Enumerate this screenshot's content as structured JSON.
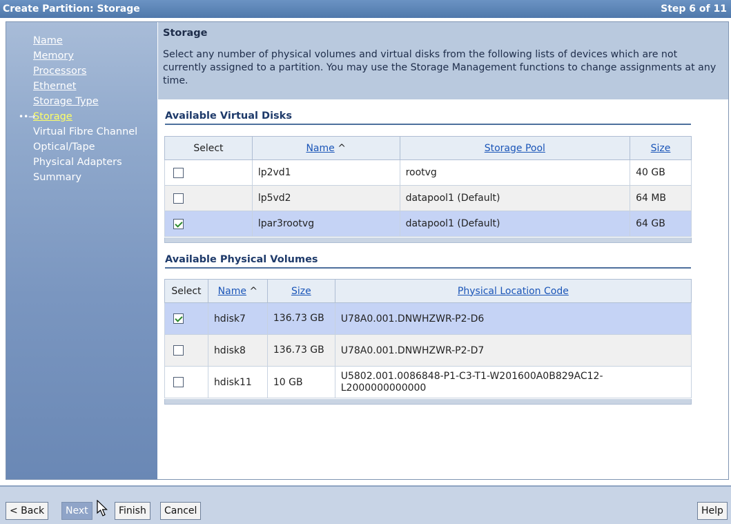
{
  "window": {
    "title": "Create Partition: Storage",
    "step": "Step 6 of 11"
  },
  "nav": {
    "items": [
      {
        "label": "Name",
        "state": "link"
      },
      {
        "label": "Memory",
        "state": "link"
      },
      {
        "label": "Processors",
        "state": "link"
      },
      {
        "label": "Ethernet",
        "state": "link"
      },
      {
        "label": "Storage Type",
        "state": "link"
      },
      {
        "label": "Storage",
        "state": "current"
      },
      {
        "label": "Virtual Fibre Channel",
        "state": "plain"
      },
      {
        "label": "Optical/Tape",
        "state": "plain"
      },
      {
        "label": "Physical Adapters",
        "state": "plain"
      },
      {
        "label": "Summary",
        "state": "plain"
      }
    ],
    "current_marker": "••→"
  },
  "content": {
    "title": "Storage",
    "description": "Select any number of physical volumes and virtual disks from the following lists of devices which are not currently assigned to a partition. You may use the Storage Management functions to change assignments at any time."
  },
  "virtual_disks": {
    "heading": "Available Virtual Disks",
    "columns": {
      "select": "Select",
      "name": "Name",
      "sort_indicator": "^",
      "pool": "Storage Pool",
      "size": "Size"
    },
    "rows": [
      {
        "checked": false,
        "name": "lp2vd1",
        "pool": "rootvg",
        "size": "40 GB"
      },
      {
        "checked": false,
        "name": "lp5vd2",
        "pool": "datapool1 (Default)",
        "size": "64 MB"
      },
      {
        "checked": true,
        "name": "lpar3rootvg",
        "pool": "datapool1 (Default)",
        "size": "64 GB"
      }
    ]
  },
  "physical_volumes": {
    "heading": "Available Physical Volumes",
    "columns": {
      "select": "Select",
      "name": "Name",
      "sort_indicator": "^",
      "size": "Size",
      "location": "Physical Location Code"
    },
    "rows": [
      {
        "checked": true,
        "name": "hdisk7",
        "size": "136.73 GB",
        "location": "U78A0.001.DNWHZWR-P2-D6"
      },
      {
        "checked": false,
        "name": "hdisk8",
        "size": "136.73 GB",
        "location": "U78A0.001.DNWHZWR-P2-D7"
      },
      {
        "checked": false,
        "name": "hdisk11",
        "size": "10 GB",
        "location": "U5802.001.0086848-P1-C3-T1-W201600A0B829AC12-L2000000000000"
      }
    ]
  },
  "buttons": {
    "back": "< Back",
    "next": "Next",
    "finish": "Finish",
    "cancel": "Cancel",
    "help": "Help"
  },
  "icons": {
    "cursor": "mouse-pointer-icon"
  }
}
